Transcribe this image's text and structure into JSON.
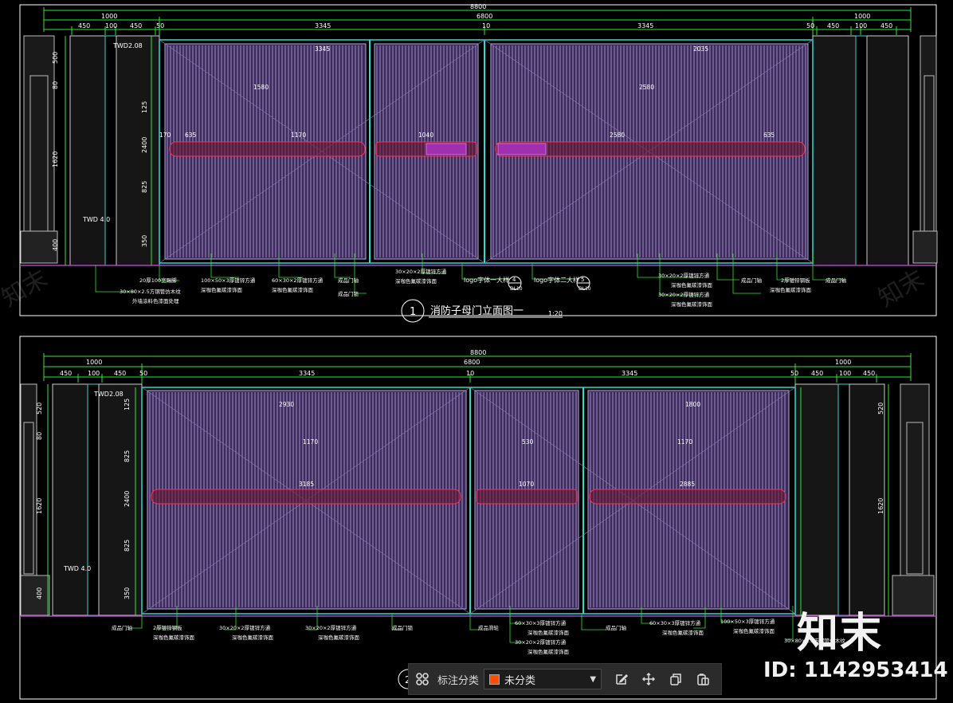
{
  "colors": {
    "background": "#000000",
    "dimension": "#2ee82e",
    "gate_fill": "#3b2a5a",
    "gate_bars": "#b8a8e0",
    "frame_cyan": "#33d6d6",
    "red_band": "#ff3050",
    "magenta": "#b040c0",
    "annotation": "#ffffff"
  },
  "drawing1": {
    "overall": "8800",
    "sides": [
      "1000",
      "1000"
    ],
    "mid": "6800",
    "leaves": [
      "3345",
      "10",
      "3345"
    ],
    "seg_left": [
      "450",
      "100",
      "450",
      "50"
    ],
    "seg_right": [
      "50",
      "450",
      "100",
      "450"
    ],
    "title_no": "1",
    "title": "消防子母门立面图一",
    "scale": "1:20",
    "heights_left": [
      "500",
      "80",
      "1620",
      "400"
    ],
    "heights_inner": [
      "125",
      "2400",
      "825",
      "350"
    ],
    "notes_top": [
      "3345",
      "1580",
      "2035",
      "2580",
      "1170",
      "1040",
      "635",
      "170"
    ],
    "tag_twd": "TWD2.08",
    "tag_twd2": "TWD 4.0",
    "callouts": [
      "20厚100宽踢脚",
      "30×80×2.5方钢管仿木纹",
      "外墙涂料色漆面处理",
      "100×50×3厚镀锌方通",
      "深咖色氟碳漆饰面",
      "60×30×2厚镀锌方通",
      "深咖色氟碳漆饰面",
      "成品门轴",
      "成品门锁",
      "30×20×2厚镀锌方通",
      "深咖色氟碳漆饰面",
      "logo字体一大样",
      "logo字体二大样",
      "30×20×2厚镀锌方通",
      "深咖色氟碳漆饰面",
      "30×20×2厚镀锌方通",
      "深咖色氟碳漆饰面",
      "成品门轴",
      "2厚镀锌钢板",
      "深咖色氟碳漆饰面",
      "成品门轴"
    ],
    "logo_refs": [
      "4",
      "5"
    ],
    "logo_sheet": "DL10"
  },
  "drawing2": {
    "overall": "8800",
    "sides": [
      "1000",
      "1000"
    ],
    "mid": "6800",
    "leaves": [
      "3345",
      "10",
      "3345"
    ],
    "seg_left": [
      "450",
      "100",
      "450",
      "50"
    ],
    "seg_right": [
      "50",
      "450",
      "100",
      "450"
    ],
    "title_no": "2",
    "heights_left": [
      "520",
      "80",
      "1620",
      "400"
    ],
    "heights_inner": [
      "125",
      "825",
      "2400",
      "825",
      "350"
    ],
    "notes_top": [
      "2930",
      "1800",
      "1170",
      "530",
      "3185",
      "1070",
      "2885"
    ],
    "tag_twd": "TWD2.08",
    "tag_twd2": "TWD 4.0",
    "callouts": [
      "成品门轴",
      "2厚镀锌钢板",
      "深咖色氟碳漆饰面",
      "30×20×2厚镀锌方通",
      "深咖色氟碳漆饰面",
      "30×20×2厚镀锌方通",
      "深咖色氟碳漆饰面",
      "成品门锁",
      "成品滑轮",
      "60×30×3厚镀锌方通",
      "深咖色氟碳漆饰面",
      "30×20×2厚镀锌方通",
      "深咖色氟碳漆饰面",
      "成品门轴",
      "60×30×3厚镀锌方通",
      "深咖色氟碳漆饰面",
      "100×50×3厚镀锌方通",
      "深咖色氟碳漆饰面",
      "30×80×2.5方钢管仿木纹"
    ]
  },
  "toolbar": {
    "label": "标注分类",
    "select_value": "未分类",
    "select_color": "#ff4d00",
    "icons": [
      "grid-icon",
      "edit-icon",
      "move-icon",
      "copy-icon",
      "paste-icon"
    ]
  },
  "watermark": {
    "logo": "知末",
    "id": "ID: 1142953414",
    "faint": "知末"
  }
}
